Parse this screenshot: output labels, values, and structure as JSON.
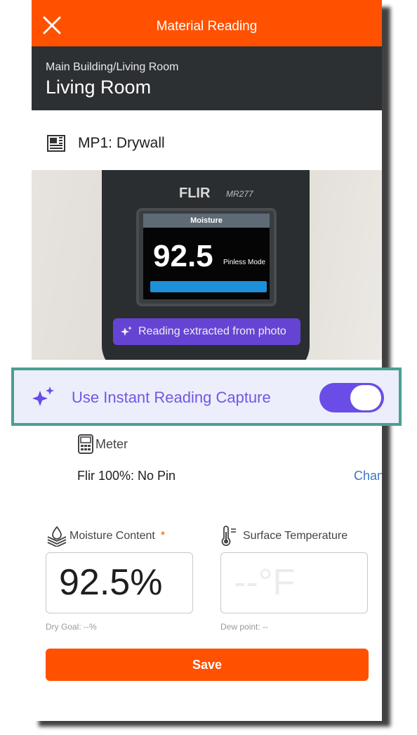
{
  "header": {
    "title": "Material Reading",
    "close_icon": "close-icon"
  },
  "location": {
    "path": "Main Building/Living Room",
    "title": "Living Room"
  },
  "material": {
    "icon": "drywall-icon",
    "label": "MP1: Drywall"
  },
  "photo": {
    "brand": "FLIR",
    "model": "MR277",
    "screen_header": "Moisture",
    "screen_value": "92.5",
    "screen_mode": "Pinless Mode",
    "ai_badge": "Reading extracted from photo"
  },
  "instant_capture": {
    "label": "Use Instant Reading Capture",
    "enabled": true,
    "accent_color": "#6a4ce6"
  },
  "meter": {
    "label": "Meter",
    "name": "Flir 100%: No Pin",
    "change_label": "Change"
  },
  "moisture": {
    "label": "Moisture Content",
    "required_mark": "*",
    "value": "92.5%",
    "hint": "Dry Goal: --%"
  },
  "surface_temp": {
    "label": "Surface Temperature",
    "placeholder": "--°F",
    "hint": "Dew point: --"
  },
  "save_label": "Save",
  "colors": {
    "brand": "#ff5100",
    "header_dark": "#2d3033",
    "link": "#3b76c1"
  }
}
